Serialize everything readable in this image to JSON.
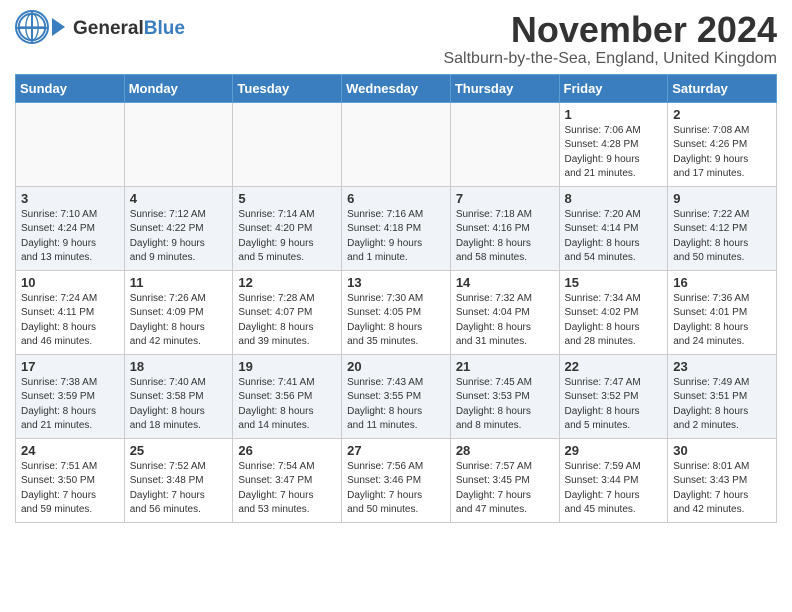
{
  "header": {
    "logo_general": "General",
    "logo_blue": "Blue",
    "month_title": "November 2024",
    "subtitle": "Saltburn-by-the-Sea, England, United Kingdom"
  },
  "weekdays": [
    "Sunday",
    "Monday",
    "Tuesday",
    "Wednesday",
    "Thursday",
    "Friday",
    "Saturday"
  ],
  "weeks": [
    [
      {
        "day": "",
        "info": ""
      },
      {
        "day": "",
        "info": ""
      },
      {
        "day": "",
        "info": ""
      },
      {
        "day": "",
        "info": ""
      },
      {
        "day": "",
        "info": ""
      },
      {
        "day": "1",
        "info": "Sunrise: 7:06 AM\nSunset: 4:28 PM\nDaylight: 9 hours\nand 21 minutes."
      },
      {
        "day": "2",
        "info": "Sunrise: 7:08 AM\nSunset: 4:26 PM\nDaylight: 9 hours\nand 17 minutes."
      }
    ],
    [
      {
        "day": "3",
        "info": "Sunrise: 7:10 AM\nSunset: 4:24 PM\nDaylight: 9 hours\nand 13 minutes."
      },
      {
        "day": "4",
        "info": "Sunrise: 7:12 AM\nSunset: 4:22 PM\nDaylight: 9 hours\nand 9 minutes."
      },
      {
        "day": "5",
        "info": "Sunrise: 7:14 AM\nSunset: 4:20 PM\nDaylight: 9 hours\nand 5 minutes."
      },
      {
        "day": "6",
        "info": "Sunrise: 7:16 AM\nSunset: 4:18 PM\nDaylight: 9 hours\nand 1 minute."
      },
      {
        "day": "7",
        "info": "Sunrise: 7:18 AM\nSunset: 4:16 PM\nDaylight: 8 hours\nand 58 minutes."
      },
      {
        "day": "8",
        "info": "Sunrise: 7:20 AM\nSunset: 4:14 PM\nDaylight: 8 hours\nand 54 minutes."
      },
      {
        "day": "9",
        "info": "Sunrise: 7:22 AM\nSunset: 4:12 PM\nDaylight: 8 hours\nand 50 minutes."
      }
    ],
    [
      {
        "day": "10",
        "info": "Sunrise: 7:24 AM\nSunset: 4:11 PM\nDaylight: 8 hours\nand 46 minutes."
      },
      {
        "day": "11",
        "info": "Sunrise: 7:26 AM\nSunset: 4:09 PM\nDaylight: 8 hours\nand 42 minutes."
      },
      {
        "day": "12",
        "info": "Sunrise: 7:28 AM\nSunset: 4:07 PM\nDaylight: 8 hours\nand 39 minutes."
      },
      {
        "day": "13",
        "info": "Sunrise: 7:30 AM\nSunset: 4:05 PM\nDaylight: 8 hours\nand 35 minutes."
      },
      {
        "day": "14",
        "info": "Sunrise: 7:32 AM\nSunset: 4:04 PM\nDaylight: 8 hours\nand 31 minutes."
      },
      {
        "day": "15",
        "info": "Sunrise: 7:34 AM\nSunset: 4:02 PM\nDaylight: 8 hours\nand 28 minutes."
      },
      {
        "day": "16",
        "info": "Sunrise: 7:36 AM\nSunset: 4:01 PM\nDaylight: 8 hours\nand 24 minutes."
      }
    ],
    [
      {
        "day": "17",
        "info": "Sunrise: 7:38 AM\nSunset: 3:59 PM\nDaylight: 8 hours\nand 21 minutes."
      },
      {
        "day": "18",
        "info": "Sunrise: 7:40 AM\nSunset: 3:58 PM\nDaylight: 8 hours\nand 18 minutes."
      },
      {
        "day": "19",
        "info": "Sunrise: 7:41 AM\nSunset: 3:56 PM\nDaylight: 8 hours\nand 14 minutes."
      },
      {
        "day": "20",
        "info": "Sunrise: 7:43 AM\nSunset: 3:55 PM\nDaylight: 8 hours\nand 11 minutes."
      },
      {
        "day": "21",
        "info": "Sunrise: 7:45 AM\nSunset: 3:53 PM\nDaylight: 8 hours\nand 8 minutes."
      },
      {
        "day": "22",
        "info": "Sunrise: 7:47 AM\nSunset: 3:52 PM\nDaylight: 8 hours\nand 5 minutes."
      },
      {
        "day": "23",
        "info": "Sunrise: 7:49 AM\nSunset: 3:51 PM\nDaylight: 8 hours\nand 2 minutes."
      }
    ],
    [
      {
        "day": "24",
        "info": "Sunrise: 7:51 AM\nSunset: 3:50 PM\nDaylight: 7 hours\nand 59 minutes."
      },
      {
        "day": "25",
        "info": "Sunrise: 7:52 AM\nSunset: 3:48 PM\nDaylight: 7 hours\nand 56 minutes."
      },
      {
        "day": "26",
        "info": "Sunrise: 7:54 AM\nSunset: 3:47 PM\nDaylight: 7 hours\nand 53 minutes."
      },
      {
        "day": "27",
        "info": "Sunrise: 7:56 AM\nSunset: 3:46 PM\nDaylight: 7 hours\nand 50 minutes."
      },
      {
        "day": "28",
        "info": "Sunrise: 7:57 AM\nSunset: 3:45 PM\nDaylight: 7 hours\nand 47 minutes."
      },
      {
        "day": "29",
        "info": "Sunrise: 7:59 AM\nSunset: 3:44 PM\nDaylight: 7 hours\nand 45 minutes."
      },
      {
        "day": "30",
        "info": "Sunrise: 8:01 AM\nSunset: 3:43 PM\nDaylight: 7 hours\nand 42 minutes."
      }
    ]
  ]
}
